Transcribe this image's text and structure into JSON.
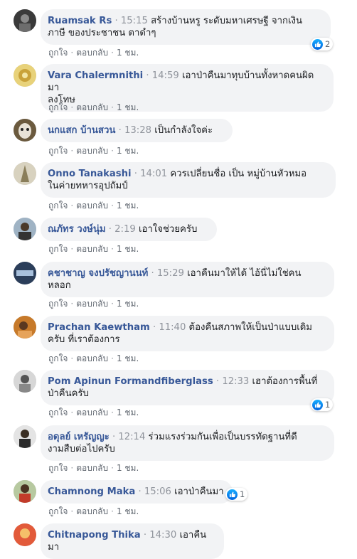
{
  "labels": {
    "like": "ถูกใจ",
    "reply": "ตอบกลับ",
    "age": "1 ชม."
  },
  "colors": {
    "author": "#385898",
    "bubble": "#f2f3f5",
    "like_blue": "#1877f2"
  },
  "comments": [
    {
      "author": "Ruamsak Rs",
      "time": "15:15",
      "line1": "สร้างบ้านหรู ระดับมหาเศรษฐี จากเงิน",
      "line2": "ภาษี ของประชาชน ตาดำๆ",
      "reactions": "2"
    },
    {
      "author": "Vara Chalermnithi",
      "time": "14:59",
      "line1": "เอาป่าคืนมาทุบบ้านทั้งหาดคนผิดมา",
      "line2": "ลงโทษ"
    },
    {
      "author": "นกแสก บ้านสวน",
      "time": "13:28",
      "line1": "เป็นกำลังใจค่ะ"
    },
    {
      "author": "Onno Tanakashi",
      "time": "14:01",
      "line1": "ควรเปลี่ยนชื่อ เป็น หมู่บ้านหัวหมอ",
      "line2": "ในค่ายทหารอุปถัมป์"
    },
    {
      "author": "ณภัทร วงษ์นุ่ม",
      "time": "2:19",
      "line1": "เอาใจช่วยครับ"
    },
    {
      "author": "คชาชาญ จงปรัชญานนท์",
      "time": "15:29",
      "line1": "เอาคืนมาให้ได้ ไอ้นี่ไม่ใช่คน",
      "line2": "หลอก"
    },
    {
      "author": "Prachan Kaewtham",
      "time": "11:40",
      "line1": "ต้องคืนสภาพให้เป็นป่าแบบเดิม",
      "line2": "ครับ ที่เราต้องการ"
    },
    {
      "author": "Pom Apinun Formandfiberglass",
      "time": "12:33",
      "line1": "เฮาต้องการพื้นที่",
      "line2": "ป่าคืนครับ",
      "reactions": "1"
    },
    {
      "author": "อดุลย์ เหรัญญะ",
      "time": "12:14",
      "line1": "ร่วมแรงร่วมกันเพื่อเป็นบรรทัดฐานที่ดี",
      "line2": "งามสืบต่อไปครับ"
    },
    {
      "author": "Chamnong Maka",
      "time": "15:06",
      "line1": "เอาป่าคืนมา",
      "reactions": "1"
    },
    {
      "author": "Chitnapong Thika",
      "time": "14:30",
      "line1": "เอาคืนมา"
    }
  ]
}
